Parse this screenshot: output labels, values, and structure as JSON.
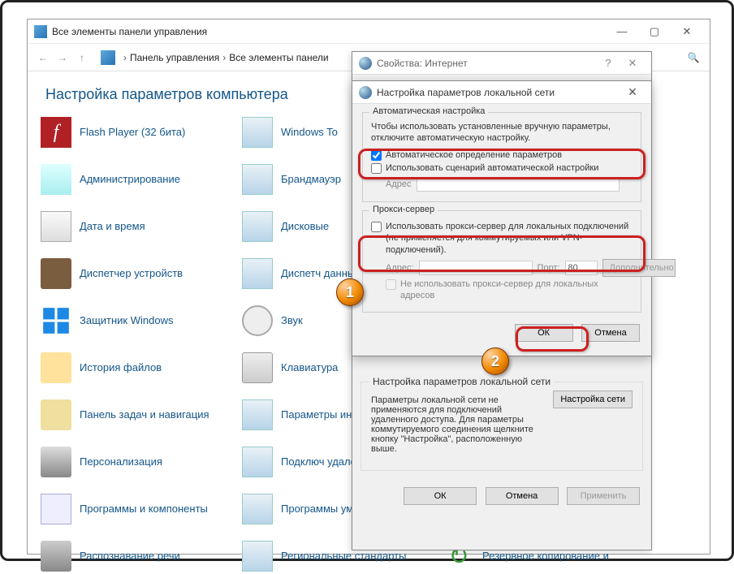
{
  "cp": {
    "title": "Все элементы панели управления",
    "breadcrumb": {
      "root": "Панель управления",
      "current": "Все элементы панели"
    },
    "heading": "Настройка параметров компьютера",
    "items": [
      {
        "label": "Flash Player (32 бита)"
      },
      {
        "label": "Windows To"
      },
      {
        "label": "Администрирование"
      },
      {
        "label": "Брандмауэр"
      },
      {
        "label": "Дата и время"
      },
      {
        "label": "Дисковые"
      },
      {
        "label": "Диспетчер устройств"
      },
      {
        "label": "Диспетч\nданных"
      },
      {
        "label": "Защитник Windows"
      },
      {
        "label": "Звук"
      },
      {
        "label": "История файлов"
      },
      {
        "label": "Клавиатура"
      },
      {
        "label": "Панель задач и навигация"
      },
      {
        "label": "Параметры индексиров"
      },
      {
        "label": "Персонализация"
      },
      {
        "label": "Подключ\nудаленны"
      },
      {
        "label": "Программы и компоненты"
      },
      {
        "label": "Программы\nумолчани"
      },
      {
        "label": "Распознавание речи"
      },
      {
        "label": "Региональные стандарты"
      },
      {
        "label": "Резервное копирование и"
      }
    ]
  },
  "ip": {
    "title": "Свойства: Интернет",
    "lan_section_title": "Настройка параметров локальной сети",
    "lan_section_desc": "Параметры локальной сети не применяются для подключений удаленного доступа. Для параметры коммутируемого соединения щелкните кнопку \"Настройка\", расположенную выше.",
    "lan_btn": "Настройка сети",
    "ok": "ОК",
    "cancel": "Отмена",
    "apply": "Применить"
  },
  "lan": {
    "title": "Настройка параметров локальной сети",
    "auto_group": "Автоматическая настройка",
    "auto_text": "Чтобы использовать установленные вручную параметры, отключите автоматическую настройку.",
    "auto_detect": "Автоматическое определение параметров",
    "auto_detect_checked": true,
    "use_script": "Использовать сценарий автоматической настройки",
    "use_script_checked": false,
    "addr_label": "Адрес",
    "proxy_group": "Прокси-сервер",
    "use_proxy": "Использовать прокси-сервер для локальных подключений (не применяется для коммутируемых или VPN-подключений).",
    "use_proxy_checked": false,
    "proxy_addr_label": "Адрес:",
    "proxy_port_label": "Порт:",
    "proxy_port_value": "80",
    "proxy_advanced": "Дополнительно",
    "bypass_local": "Не использовать прокси-сервер для локальных адресов",
    "ok": "ОК",
    "cancel": "Отмена"
  },
  "markers": {
    "m1": "1",
    "m2": "2"
  }
}
